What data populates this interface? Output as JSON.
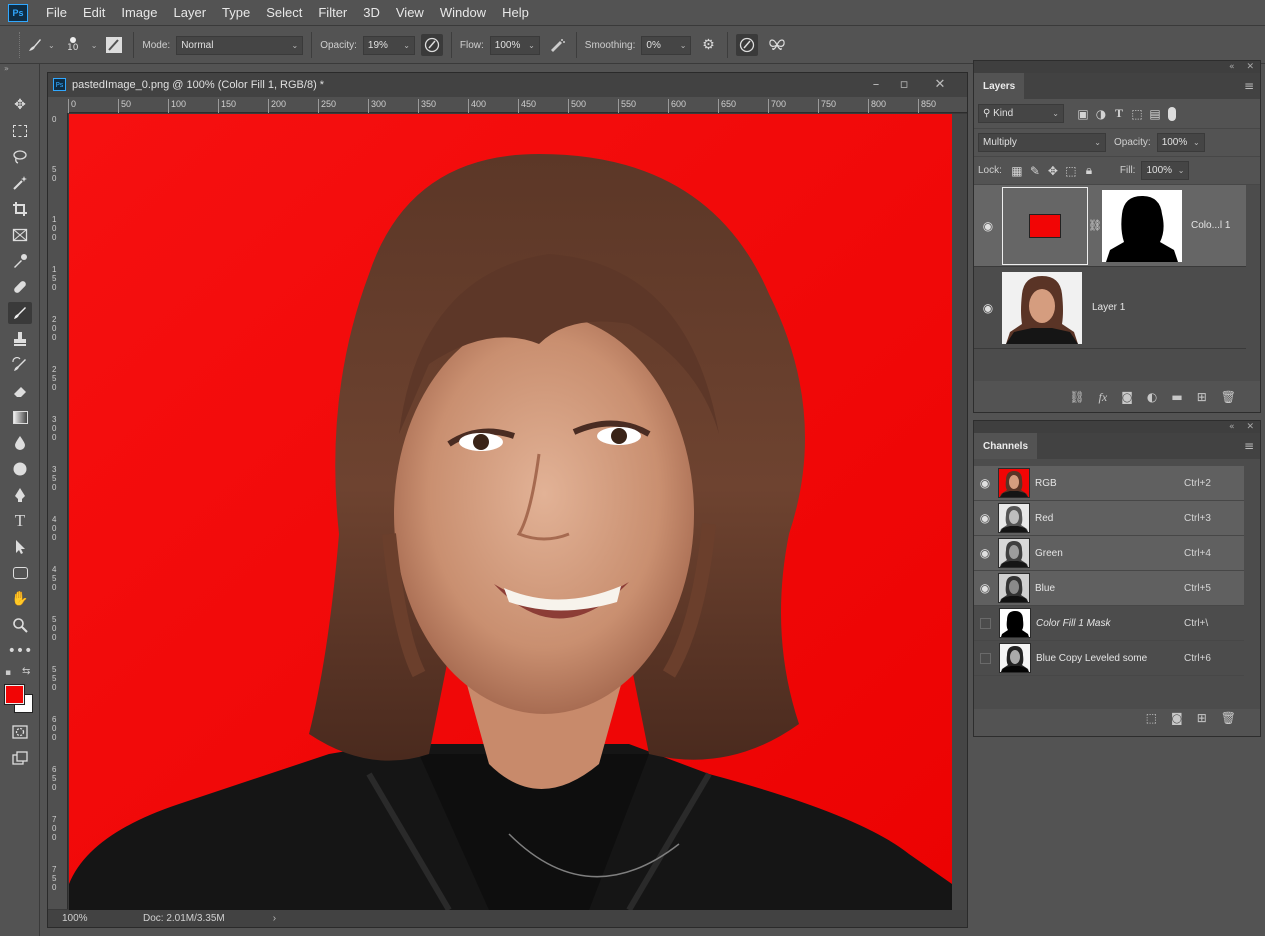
{
  "app": {
    "logo": "Ps"
  },
  "menu": [
    "File",
    "Edit",
    "Image",
    "Layer",
    "Type",
    "Select",
    "Filter",
    "3D",
    "View",
    "Window",
    "Help"
  ],
  "options": {
    "brush_size": "10",
    "mode_label": "Mode:",
    "mode_value": "Normal",
    "opacity_label": "Opacity:",
    "opacity_value": "19%",
    "flow_label": "Flow:",
    "flow_value": "100%",
    "smoothing_label": "Smoothing:",
    "smoothing_value": "0%"
  },
  "document": {
    "title": "pastedImage_0.png @ 100% (Color Fill 1, RGB/8) *",
    "zoom": "100%",
    "doc_size": "Doc: 2.01M/3.35M",
    "ruler_top": [
      "0",
      "50",
      "100",
      "150",
      "200",
      "250",
      "300",
      "350",
      "400",
      "450",
      "500",
      "550",
      "600",
      "650",
      "700",
      "750",
      "800",
      "850"
    ],
    "ruler_left": [
      "0",
      "50",
      "100",
      "150",
      "200",
      "250",
      "300",
      "350",
      "400",
      "450",
      "500",
      "550",
      "600",
      "650",
      "700",
      "750"
    ]
  },
  "colors": {
    "foreground": "#f20505",
    "background": "#ffffff",
    "canvas_fill": "#f20505"
  },
  "layers_panel": {
    "tab": "Layers",
    "filter_kind": "Kind",
    "blend_mode": "Multiply",
    "opacity_label": "Opacity:",
    "opacity_value": "100%",
    "lock_label": "Lock:",
    "fill_label": "Fill:",
    "fill_value": "100%",
    "layers": [
      {
        "name": "Colo...l 1",
        "visible": true,
        "selected": true
      },
      {
        "name": "Layer 1",
        "visible": true,
        "selected": false
      }
    ]
  },
  "channels_panel": {
    "tab": "Channels",
    "channels": [
      {
        "name": "RGB",
        "shortcut": "Ctrl+2",
        "visible": true
      },
      {
        "name": "Red",
        "shortcut": "Ctrl+3",
        "visible": true
      },
      {
        "name": "Green",
        "shortcut": "Ctrl+4",
        "visible": true
      },
      {
        "name": "Blue",
        "shortcut": "Ctrl+5",
        "visible": true
      },
      {
        "name": "Color Fill 1 Mask",
        "shortcut": "Ctrl+\\",
        "visible": false
      },
      {
        "name": "Blue Copy Leveled some",
        "shortcut": "Ctrl+6",
        "visible": false
      }
    ]
  }
}
